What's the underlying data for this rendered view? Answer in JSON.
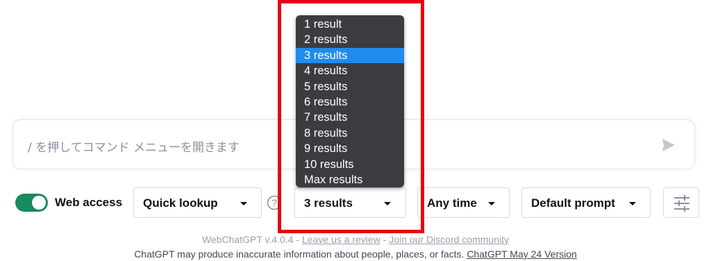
{
  "prompt": {
    "placeholder": "/ を押してコマンド メニューを開きます"
  },
  "toolbar": {
    "web_access_label": "Web access",
    "web_access_on": true,
    "mode_label": "Quick lookup",
    "results_label": "3 results",
    "time_label": "Any time",
    "prompt_label": "Default prompt"
  },
  "results_menu": {
    "options": [
      "1 result",
      "2 results",
      "3 results",
      "4 results",
      "5 results",
      "6 results",
      "7 results",
      "8 results",
      "9 results",
      "10 results",
      "Max results"
    ],
    "selected": "3 results"
  },
  "footer": {
    "version": "WebChatGPT v.4.0.4 - ",
    "review_link": "Leave us a review",
    "sep": " - ",
    "discord_link": "Join our Discord community",
    "disclaimer": "ChatGPT may produce inaccurate information about people, places, or facts. ",
    "version_link": "ChatGPT May 24 Version"
  },
  "colors": {
    "toggle_on": "#178a5e",
    "menu_bg": "#3c3b40",
    "menu_selected": "#1f8cf0",
    "highlight": "#e60012"
  },
  "icons": [
    "send-icon",
    "help-icon",
    "settings-sliders-icon",
    "chevron-down-icon"
  ]
}
